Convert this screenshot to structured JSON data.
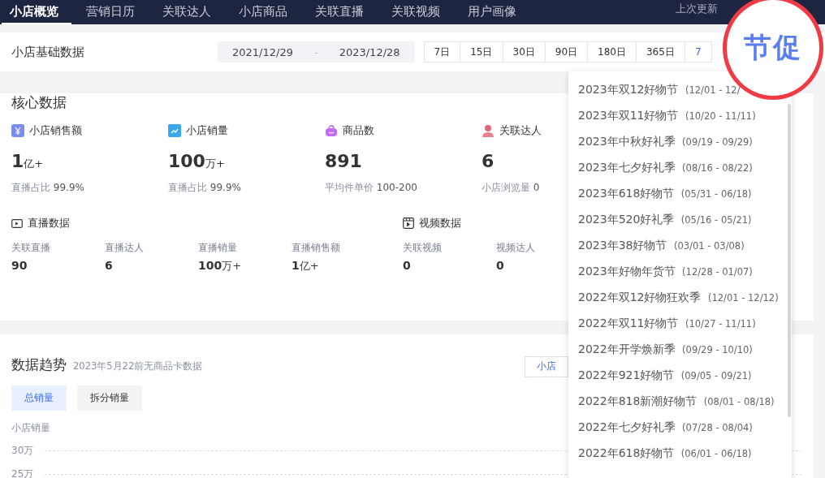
{
  "nav": {
    "tabs": [
      {
        "label": "小店概览",
        "selected": true
      },
      {
        "label": "营销日历",
        "selected": false
      },
      {
        "label": "关联达人",
        "selected": false
      },
      {
        "label": "小店商品",
        "selected": false
      },
      {
        "label": "关联直播",
        "selected": false
      },
      {
        "label": "关联视频",
        "selected": false
      },
      {
        "label": "用户画像",
        "selected": false
      }
    ],
    "update_note": "上次更新"
  },
  "basic": {
    "title": "小店基础数据",
    "start_date": "2021/12/29",
    "separator": "-",
    "end_date": "2023/12/28",
    "ranges": [
      {
        "label": "7日",
        "selected": false
      },
      {
        "label": "15日",
        "selected": false
      },
      {
        "label": "30日",
        "selected": false
      },
      {
        "label": "90日",
        "selected": false
      },
      {
        "label": "180日",
        "selected": false
      },
      {
        "label": "365日",
        "selected": false
      },
      {
        "label": "7",
        "selected": true
      }
    ]
  },
  "core": {
    "title": "核心数据",
    "metrics": [
      {
        "kind": "money",
        "label": "小店销售额",
        "value": "1",
        "unit": "亿+",
        "sub_label": "直播占比",
        "sub_value": "99.9%"
      },
      {
        "kind": "trend",
        "label": "小店销量",
        "value": "100",
        "unit": "万+",
        "sub_label": "直播占比",
        "sub_value": "99.9%"
      },
      {
        "kind": "bag",
        "label": "商品数",
        "value": "891",
        "sub_label": "平均件单价",
        "sub_value": "100-200"
      },
      {
        "kind": "person",
        "label": "关联达人",
        "value": "6",
        "sub_label": "小店浏览量",
        "sub_value": "0"
      }
    ],
    "live": {
      "title": "直播数据",
      "stats": [
        {
          "label": "关联直播",
          "value": "90"
        },
        {
          "label": "直播达人",
          "value": "6"
        },
        {
          "label": "直播销量",
          "value": "100",
          "unit": "万+"
        },
        {
          "label": "直播销售额",
          "value": "1",
          "unit": "亿+"
        }
      ]
    },
    "video": {
      "title": "视频数据",
      "stats": [
        {
          "label": "关联视频",
          "value": "0"
        },
        {
          "label": "视频达人",
          "value": "0"
        }
      ]
    }
  },
  "trend": {
    "title": "数据趋势",
    "note": "2023年5月22前无商品卡数据",
    "selector": "小店",
    "toggles": [
      {
        "label": "总销量",
        "selected": true
      },
      {
        "label": "拆分销量",
        "selected": false
      }
    ],
    "axis_title": "小店销量",
    "yticks": [
      "30万",
      "25万"
    ]
  },
  "dropdown": {
    "items": [
      {
        "name": "2023年双12好物节",
        "range": "(12/01 - 12/"
      },
      {
        "name": "2023年双11好物节",
        "range": "(10/20 - 11/11)"
      },
      {
        "name": "2023年中秋好礼季",
        "range": "(09/19 - 09/29)"
      },
      {
        "name": "2023年七夕好礼季",
        "range": "(08/16 - 08/22)"
      },
      {
        "name": "2023年618好物节",
        "range": "(05/31 - 06/18)"
      },
      {
        "name": "2023年520好礼季",
        "range": "(05/16 - 05/21)"
      },
      {
        "name": "2023年38好物节",
        "range": "(03/01 - 03/08)"
      },
      {
        "name": "2023年好物年货节",
        "range": "(12/28 - 01/07)"
      },
      {
        "name": "2022年双12好物狂欢季",
        "range": "(12/01 - 12/12)"
      },
      {
        "name": "2022年双11好物节",
        "range": "(10/27 - 11/11)"
      },
      {
        "name": "2022年开学焕新季",
        "range": "(09/29 - 10/10)"
      },
      {
        "name": "2022年921好物节",
        "range": "(09/05 - 09/21)"
      },
      {
        "name": "2022年818新潮好物节",
        "range": "(08/01 - 08/18)"
      },
      {
        "name": "2022年七夕好礼季",
        "range": "(07/28 - 08/04)"
      },
      {
        "name": "2022年618好物节",
        "range": "(06/01 - 06/18)"
      }
    ]
  },
  "annotation": {
    "text": "节促"
  }
}
